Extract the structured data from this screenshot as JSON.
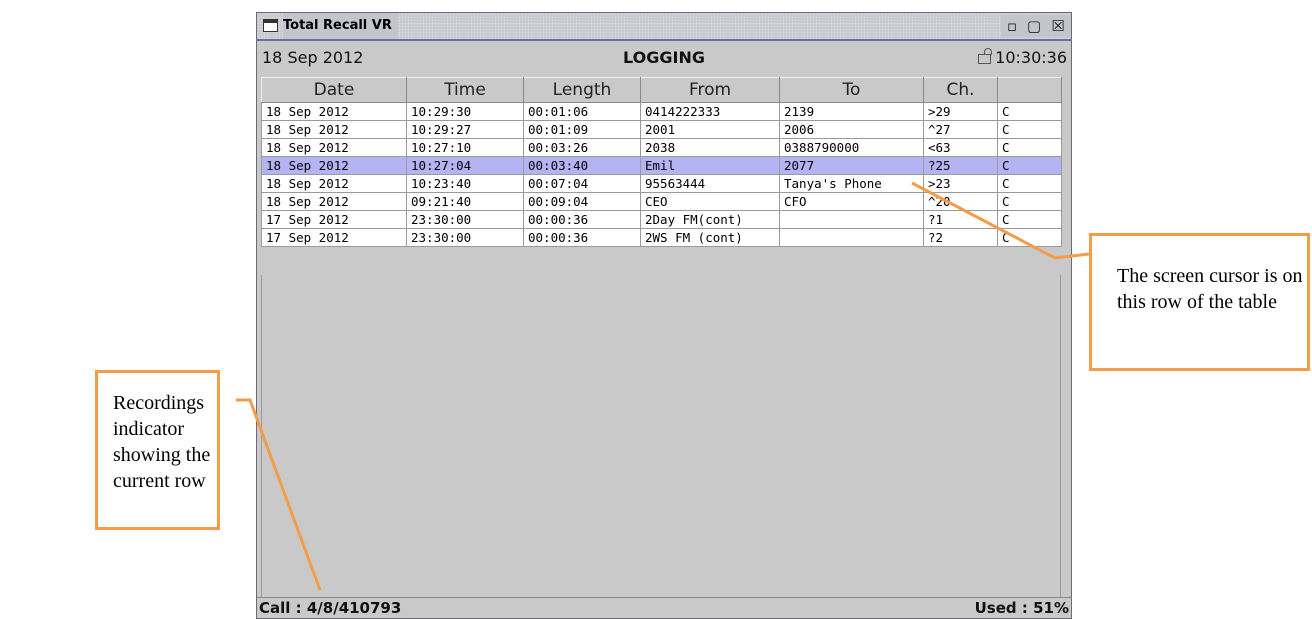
{
  "window": {
    "title": "Total Recall VR",
    "controls": {
      "minimize": "▫",
      "maximize": "▢",
      "close": "☒"
    }
  },
  "header": {
    "date": "18 Sep 2012",
    "mode": "LOGGING",
    "time": "10:30:36"
  },
  "table": {
    "columns": [
      "Date",
      "Time",
      "Length",
      "From",
      "To",
      "Ch.",
      ""
    ],
    "rows": [
      [
        "18 Sep 2012",
        "10:29:30",
        "00:01:06",
        "0414222333",
        "2139",
        ">29",
        "C"
      ],
      [
        "18 Sep 2012",
        "10:29:27",
        "00:01:09",
        "2001",
        "2006",
        "^27",
        "C"
      ],
      [
        "18 Sep 2012",
        "10:27:10",
        "00:03:26",
        "2038",
        "0388790000",
        "<63",
        "C"
      ],
      [
        "18 Sep 2012",
        "10:27:04",
        "00:03:40",
        "Emil",
        "2077",
        "?25",
        "C"
      ],
      [
        "18 Sep 2012",
        "10:23:40",
        "00:07:04",
        "95563444",
        "Tanya's Phone",
        ">23",
        "C"
      ],
      [
        "18 Sep 2012",
        "09:21:40",
        "00:09:04",
        "CEO",
        "CFO",
        "^20",
        "C"
      ],
      [
        "17 Sep 2012",
        "23:30:00",
        "00:00:36",
        "2Day FM(cont)",
        "",
        "?1",
        "C"
      ],
      [
        "17 Sep 2012",
        "23:30:00",
        "00:00:36",
        "2WS FM (cont)",
        "",
        "?2",
        "C"
      ]
    ],
    "selected_row": 3,
    "selected_color": "#b4b4f4"
  },
  "status": {
    "call": "Call : 4/8/410793",
    "used": "Used : 51%"
  },
  "annotations": {
    "recordings_indicator": "Recordings indicator showing the current row",
    "cursor_row": "The screen cursor is on this row of the table",
    "callout_color": "#f39c4a"
  }
}
